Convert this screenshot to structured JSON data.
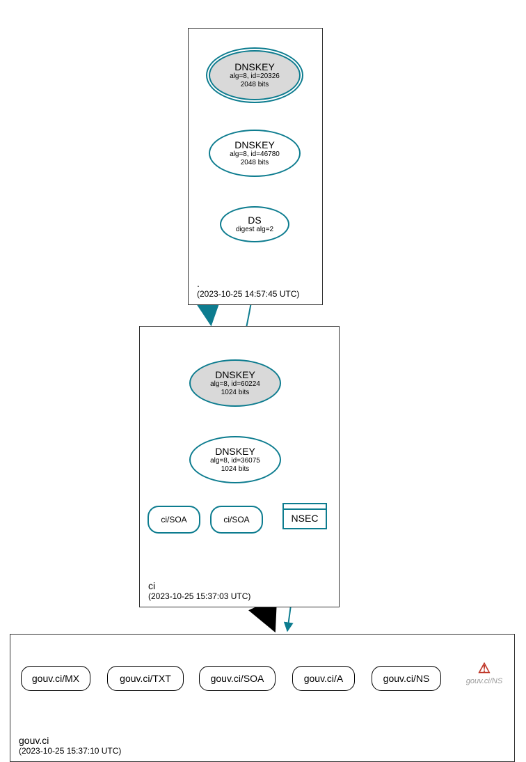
{
  "colors": {
    "teal": "#0d7c8f",
    "black": "#000000",
    "shaded": "#d9d9d9",
    "warn": "#c0392b",
    "gray": "#999999"
  },
  "zones": {
    "root": {
      "name": ".",
      "timestamp": "(2023-10-25 14:57:45 UTC)",
      "nodes": {
        "ksk": {
          "title": "DNSKEY",
          "sub1": "alg=8, id=20326",
          "sub2": "2048 bits"
        },
        "zsk": {
          "title": "DNSKEY",
          "sub1": "alg=8, id=46780",
          "sub2": "2048 bits"
        },
        "ds": {
          "title": "DS",
          "sub1": "digest alg=2"
        }
      }
    },
    "ci": {
      "name": "ci",
      "timestamp": "(2023-10-25 15:37:03 UTC)",
      "nodes": {
        "ksk": {
          "title": "DNSKEY",
          "sub1": "alg=8, id=60224",
          "sub2": "1024 bits"
        },
        "zsk": {
          "title": "DNSKEY",
          "sub1": "alg=8, id=36075",
          "sub2": "1024 bits"
        },
        "soa1": "ci/SOA",
        "soa2": "ci/SOA",
        "nsec": "NSEC"
      }
    },
    "gouvci": {
      "name": "gouv.ci",
      "timestamp": "(2023-10-25 15:37:10 UTC)",
      "records": {
        "mx": "gouv.ci/MX",
        "txt": "gouv.ci/TXT",
        "soa": "gouv.ci/SOA",
        "a": "gouv.ci/A",
        "ns": "gouv.ci/NS",
        "ns_warn": "gouv.ci/NS"
      }
    }
  }
}
